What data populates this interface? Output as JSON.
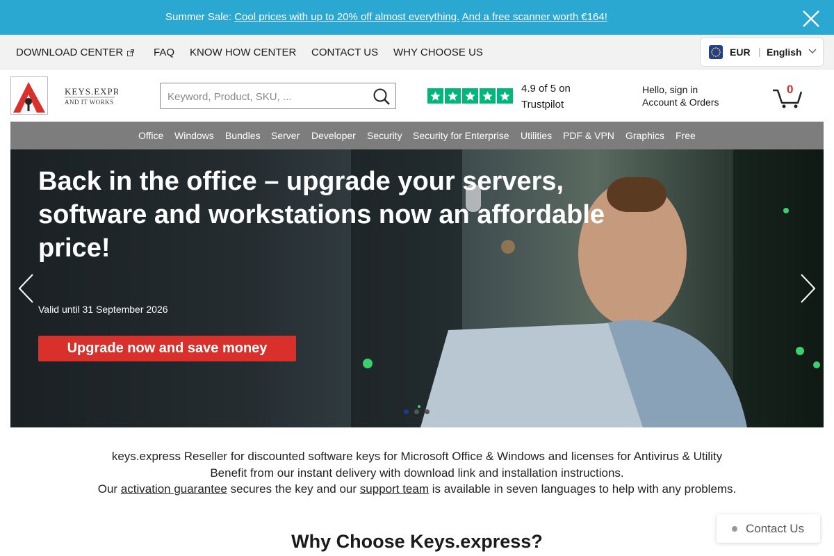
{
  "promo": {
    "lead": "Summer Sale: ",
    "link1": "Cool prices with up to 20% off almost everything.",
    "link2": "And a free scanner worth €164!"
  },
  "topnav": {
    "items": [
      "DOWNLOAD CENTER",
      "FAQ",
      "KNOW HOW CENTER",
      "CONTACT US",
      "WHY CHOOSE US"
    ],
    "currency": "EUR",
    "separator": "|",
    "language": "English"
  },
  "header": {
    "logo_text": "KEYS.EXPRESS",
    "logo_tagline": "AND IT WORKS",
    "search_placeholder": "Keyword, Product, SKU, ...",
    "rating_text": "4.9 of 5 on Trustpilot",
    "account_hello": "Hello, sign in",
    "account_orders": "Account & Orders",
    "cart_count": "0"
  },
  "categories": [
    "Office",
    "Windows",
    "Bundles",
    "Server",
    "Developer",
    "Security",
    "Security for Enterprise",
    "Utilities",
    "PDF & VPN",
    "Graphics",
    "Free"
  ],
  "hero": {
    "title": "Back in the office – upgrade your servers, software and workstations now an affordable price!",
    "valid": "Valid until 31 September 2026",
    "cta": "Upgrade now and save money",
    "slide_count": 3,
    "active_slide": 1
  },
  "intro": {
    "line1": "keys.express Reseller for discounted software keys for Microsoft Office & Windows and licenses for Antivirus & Utility",
    "line2": "Benefit from our instant delivery with download link and installation instructions.",
    "line3_a": "Our ",
    "line3_link1": "activation guarantee",
    "line3_b": " secures the key and our ",
    "line3_link2": "support team",
    "line3_c": " is available in seven languages to help with any problems."
  },
  "why_title": "Why Choose Keys.express?",
  "contact": {
    "label": "Contact Us"
  },
  "colors": {
    "promo_bg": "#2aa8d1",
    "category_bar": "#7d7d7d",
    "cta_red": "#d9302c",
    "trustpilot_green": "#00b67a"
  }
}
